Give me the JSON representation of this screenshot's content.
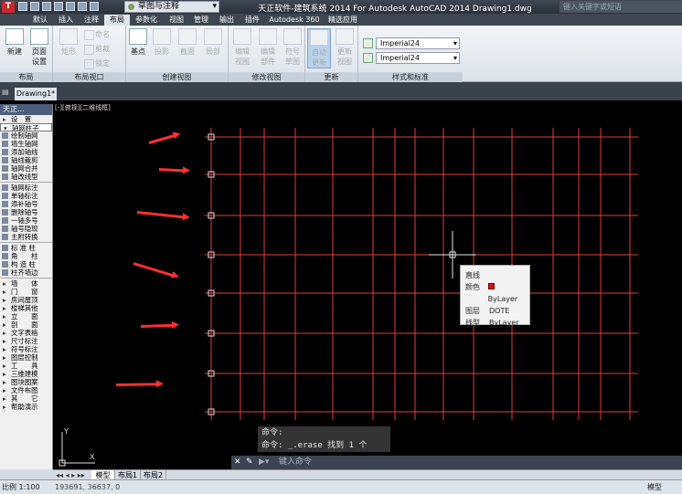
{
  "titlebar": {
    "workspace": "草图与注释",
    "title": "天正软件-建筑系统 2014  For Autodesk AutoCAD 2014    Drawing1.dwg",
    "search_placeholder": "键入关键字或短语"
  },
  "ribbon_tabs": [
    "默认",
    "插入",
    "注释",
    "布局",
    "参数化",
    "视图",
    "管理",
    "输出",
    "插件",
    "Autodesk 360",
    "精选应用"
  ],
  "ribbon": {
    "layout": {
      "title": "布局",
      "new": "新建",
      "page_setup": "页面\n设置"
    },
    "viewport": {
      "title": "布局视口",
      "rect": "矩形",
      "name": "命名",
      "clip": "剪裁",
      "lock": "锁定"
    },
    "create_view": {
      "title": "创建视图",
      "base": "基点",
      "projected": "投影",
      "section": "截面",
      "detail": "局部"
    },
    "modify_view": {
      "title": "修改视图",
      "edit_view": "编辑\n视图",
      "edit_comp": "编辑\n部件",
      "symbol": "符号\n草图"
    },
    "update": {
      "title": "更新",
      "auto": "自动\n更新",
      "update_view": "更新\n视图"
    },
    "style": {
      "title": "样式和标准",
      "combo1": "Imperial24",
      "combo2": "Imperial24"
    }
  },
  "doc_tab": "Drawing1*",
  "view_label": "[-][俯视][二维线框]",
  "sidebar": {
    "title": "天正...",
    "items": [
      {
        "label": "设　置",
        "kind": "cat"
      },
      {
        "label": "轴网柱子",
        "kind": "open"
      },
      {
        "label": "绘制轴网",
        "kind": "item"
      },
      {
        "label": "墙生轴网",
        "kind": "item"
      },
      {
        "label": "添加轴线",
        "kind": "item"
      },
      {
        "label": "轴线裁剪",
        "kind": "item"
      },
      {
        "label": "轴网合并",
        "kind": "item"
      },
      {
        "label": "轴改线型",
        "kind": "item"
      },
      {
        "label": "轴网标注",
        "kind": "item"
      },
      {
        "label": "单轴标注",
        "kind": "item"
      },
      {
        "label": "添补轴号",
        "kind": "item"
      },
      {
        "label": "删除轴号",
        "kind": "item"
      },
      {
        "label": "一轴多号",
        "kind": "item"
      },
      {
        "label": "轴号隐现",
        "kind": "item"
      },
      {
        "label": "主附转换",
        "kind": "item"
      },
      {
        "label": "标 准 柱",
        "kind": "item"
      },
      {
        "label": "角　　柱",
        "kind": "item"
      },
      {
        "label": "构 造 柱",
        "kind": "item"
      },
      {
        "label": "柱齐墙边",
        "kind": "item"
      },
      {
        "label": "墙　　体",
        "kind": "cat"
      },
      {
        "label": "门　　窗",
        "kind": "cat"
      },
      {
        "label": "房间屋顶",
        "kind": "cat"
      },
      {
        "label": "楼梯其他",
        "kind": "cat"
      },
      {
        "label": "立　　面",
        "kind": "cat"
      },
      {
        "label": "剖　　面",
        "kind": "cat"
      },
      {
        "label": "文字表格",
        "kind": "cat"
      },
      {
        "label": "尺寸标注",
        "kind": "cat"
      },
      {
        "label": "符号标注",
        "kind": "cat"
      },
      {
        "label": "图层控制",
        "kind": "cat"
      },
      {
        "label": "工　　具",
        "kind": "cat"
      },
      {
        "label": "三维建模",
        "kind": "cat"
      },
      {
        "label": "图块图案",
        "kind": "cat"
      },
      {
        "label": "文件布图",
        "kind": "cat"
      },
      {
        "label": "其　　它",
        "kind": "cat"
      },
      {
        "label": "帮助演示",
        "kind": "cat"
      }
    ]
  },
  "tooltip": {
    "title": "直线",
    "rows": [
      {
        "k": "颜色",
        "v": "ByLayer"
      },
      {
        "k": "图层",
        "v": "DOTE"
      },
      {
        "k": "线型",
        "v": "ByLayer"
      }
    ]
  },
  "command": {
    "history": [
      "命令:",
      "命令: _.erase 找到 1 个"
    ],
    "placeholder": "键入命令"
  },
  "layouts": [
    "模型",
    "布局1",
    "布局2"
  ],
  "status": {
    "scale": "比例 1:100",
    "coords": "193691, 36637, 0",
    "mode": "模型"
  },
  "colors": {
    "grid": "#e23a3a",
    "arrow": "#ff2f2f",
    "ribbon_bg": "#e8edf2",
    "canvas": "#000000"
  }
}
